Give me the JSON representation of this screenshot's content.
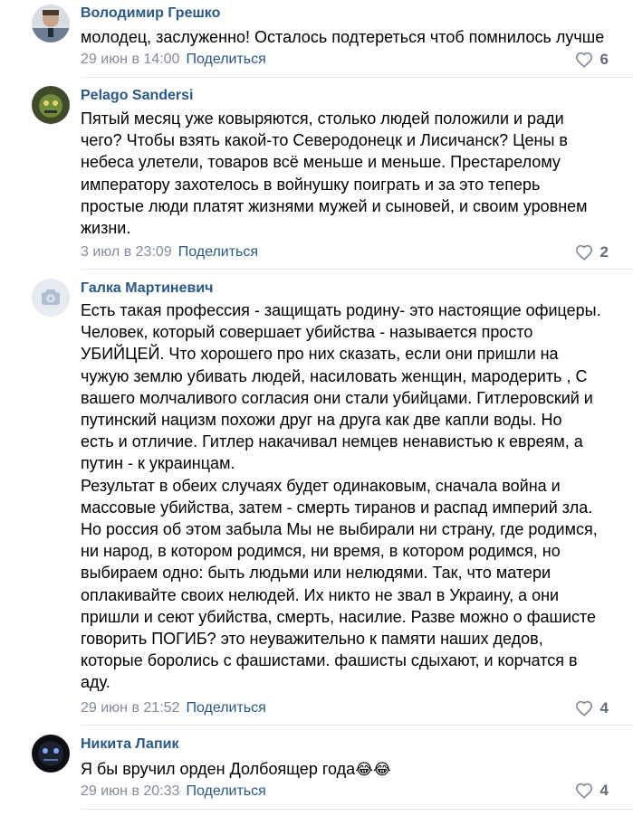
{
  "comments": [
    {
      "author": "Володимир Грешко",
      "text": "молодец, заслуженно! Осталось подтереться чтоб помнилось лучше",
      "date": "29 июн в 14:00",
      "share": "Поделиться",
      "likes": "6"
    },
    {
      "author": "Pelago Sandersi",
      "text": "Пятый месяц уже ковыряются, столько людей положили и ради\nчего? Чтобы взять какой-то Северодонецк и Лисичанск? Цены в\nнебеса улетели, товаров всё меньше и меньше. Престарелому\nимператору захотелось в войнушку поиграть и за это теперь\nпростые люди платят жизнями мужей и сыновей, и своим уровнем\nжизни.",
      "date": "3 июл в 23:09",
      "share": "Поделиться",
      "likes": "2"
    },
    {
      "author": "Галка Мартиневич",
      "text": "Есть такая профессия - защищать родину- это настоящие офицеры.\nЧеловек, который совершает убийства - называется просто\nУБИЙЦЕЙ. Что хорошего про них сказать, если они пришли на\nчужую землю убивать людей, насиловать женщин, мародерить , С\nвашего молчаливого согласия они стали убийцами. Гитлеровский и\nпутинский нацизм похожи друг на друга как две капли воды. Но\nесть и отличие. Гитлер накачивал немцев ненавистью к евреям, а\nпутин - к украинцам.\nРезультат в обеих случаях будет одинаковым, сначала война и\nмассовые убийства, затем - смерть тиранов и распад империй зла.\nНо россия об этом забыла Мы не выбирали ни страну, где родимся,\nни народ, в котором родимся, ни время, в котором родимся, но\nвыбираем одно: быть людьми или нелюдями. Так, что матери\nоплакивайте своих нелюдей. Их никто не звал в Украину, а они\nпришли и сеют убийства, смерть, насилие. Разве можно о фашисте\nговорить ПОГИБ? это неуважительно к памяти наших дедов,\nкоторые боролись с фашистами. фашисты сдыхают, и корчатся в\nаду.",
      "date": "29 июн в 21:52",
      "share": "Поделиться",
      "likes": "4"
    },
    {
      "author": "Никита Лапик",
      "text": "Я бы вручил орден Долбоящер года",
      "emoji": "😂😂",
      "date": "29 июн в 20:33",
      "share": "Поделиться",
      "likes": "4"
    }
  ],
  "colors": {
    "author": "#2a5885",
    "date": "#818c99",
    "like": "#626d7a",
    "divider": "#e7e8ec"
  },
  "icons": {
    "like": "heart-icon",
    "no_photo": "camera-icon"
  }
}
